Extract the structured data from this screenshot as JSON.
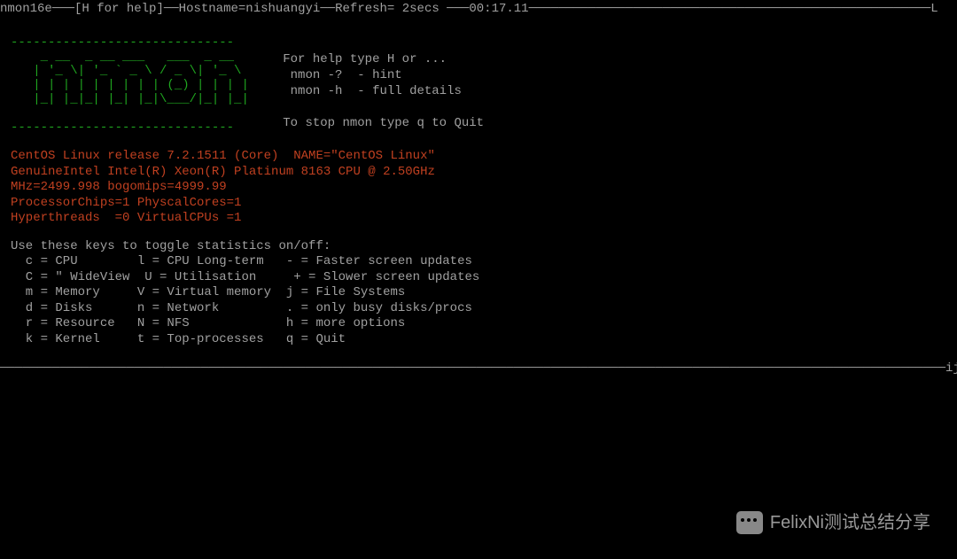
{
  "header": {
    "version": "nmon16e",
    "help_hint": "[H for help]",
    "hostname_label": "Hostname=",
    "hostname": "nishuangyi",
    "refresh_label": "Refresh=",
    "refresh": " 2secs",
    "time": "00:17.11",
    "right_char": "L"
  },
  "ascii": {
    "art": "------------------------------\n    _ __  _ __ ___   ___  _ __  \n   | '_ \\| '_ ` _ \\ / _ \\| '_ \\ \n   | | | | | | | | | (_) | | | |\n   |_| |_|_| |_| |_|\\___/|_| |_|\n                                 \n------------------------------"
  },
  "help": {
    "line1": "For help type H or ...",
    "line2": " nmon -?  - hint",
    "line3": " nmon -h  - full details",
    "line4": "",
    "line5": "To stop nmon type q to Quit"
  },
  "sysinfo": {
    "line1": "CentOS Linux release 7.2.1511 (Core)  NAME=\"CentOS Linux\"",
    "line2": "GenuineIntel Intel(R) Xeon(R) Platinum 8163 CPU @ 2.50GHz",
    "line3": "MHz=2499.998 bogomips=4999.99",
    "line4": "ProcessorChips=1 PhyscalCores=1",
    "line5": "Hyperthreads  =0 VirtualCPUs =1"
  },
  "keys": {
    "header": "Use these keys to toggle statistics on/off:",
    "rows": [
      "  c = CPU        l = CPU Long-term   - = Faster screen updates",
      "  C = \" WideView  U = Utilisation     + = Slower screen updates",
      "  m = Memory     V = Virtual memory  j = File Systems",
      "  d = Disks      n = Network         . = only busy disks/procs",
      "  r = Resource   N = NFS             h = more options",
      "  k = Kernel     t = Top-processes   q = Quit"
    ]
  },
  "footer": {
    "suffix": "ij"
  },
  "watermark": {
    "text": "FelixNi测试总结分享"
  }
}
